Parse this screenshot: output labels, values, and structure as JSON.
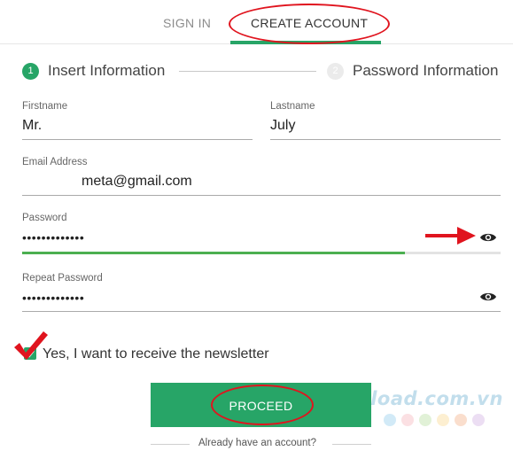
{
  "tabs": {
    "sign_in": "SIGN IN",
    "create_account": "CREATE ACCOUNT"
  },
  "steps": [
    {
      "number": "1",
      "label": "Insert Information"
    },
    {
      "number": "2",
      "label": "Password Information"
    }
  ],
  "form": {
    "firstname_label": "Firstname",
    "firstname_value": "Mr.",
    "lastname_label": "Lastname",
    "lastname_value": "July",
    "email_label": "Email Address",
    "email_value": "meta@gmail.com",
    "password_label": "Password",
    "password_value": "•••••••••••••",
    "password_strength": 0.8,
    "repeat_password_label": "Repeat Password",
    "repeat_password_value": "•••••••••••••"
  },
  "newsletter": {
    "checked": true,
    "label": "Yes, I want to receive the newsletter"
  },
  "actions": {
    "proceed_label": "PROCEED",
    "already_account": "Already have an account?"
  },
  "watermark": {
    "text": "Download.com.vn"
  },
  "icons": {
    "step_active": "step-circle-active",
    "step_inactive": "step-circle-inactive",
    "password_toggle": "eye-icon",
    "checkbox": "check-icon",
    "annotation_arrow": "red-arrow-icon",
    "annotation_check": "red-checkmark-icon"
  },
  "colors": {
    "accent": "#27a567",
    "annotation": "#e0141e",
    "strength": "#4caf50"
  }
}
